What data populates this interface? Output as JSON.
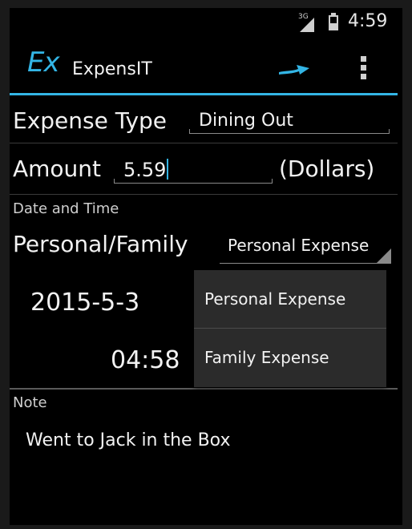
{
  "status_bar": {
    "network_label": "3G",
    "time": "4:59"
  },
  "action_bar": {
    "logo_text": "Ex",
    "app_title": "ExpensIT",
    "send_icon": "send-arrow-icon",
    "overflow_icon": "overflow-menu-icon"
  },
  "form": {
    "expense_type_label": "Expense Type",
    "expense_type_value": "Dining Out",
    "amount_label": "Amount",
    "amount_value": "5.59",
    "amount_unit": "(Dollars)",
    "date_time_header": "Date and Time",
    "personal_family_label": "Personal/Family",
    "personal_family_selected": "Personal Expense",
    "date_value": "2015-5-3",
    "time_value": "04:58",
    "note_header": "Note",
    "note_value": "Went to Jack in the Box"
  },
  "dropdown": {
    "options": [
      "Personal Expense",
      "Family Expense"
    ]
  },
  "colors": {
    "accent": "#33b5e5",
    "background": "#000000",
    "dropdown_bg": "#2b2b2b"
  }
}
